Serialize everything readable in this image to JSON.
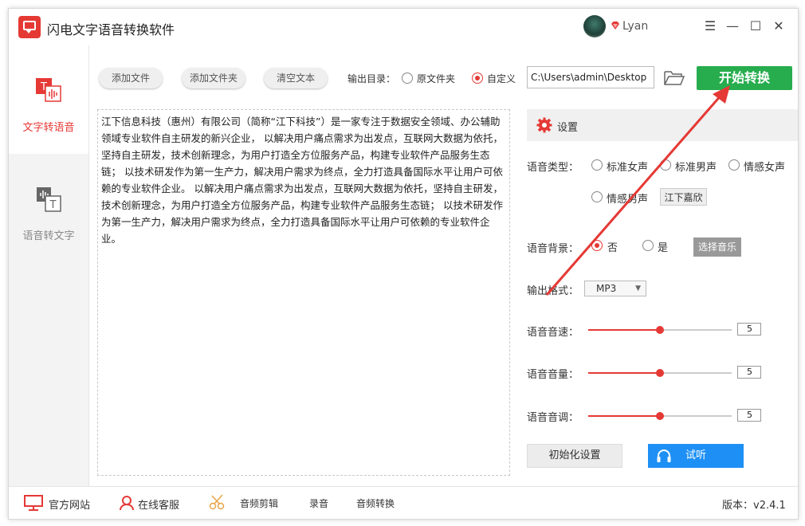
{
  "app": {
    "title": "闪电文字语音转换软件",
    "user": "Lyan"
  },
  "sidebar": {
    "items": [
      {
        "label": "文字转语音"
      },
      {
        "label": "语音转文字"
      }
    ]
  },
  "toolbar": {
    "add_file": "添加文件",
    "add_folder": "添加文件夹",
    "clear_text": "清空文本",
    "output_dir_label": "输出目录：",
    "original_folder": "原文件夹",
    "custom": "自定义",
    "output_path": "C:\\Users\\admin\\Desktop",
    "start": "开始转换"
  },
  "editor": {
    "text": "江下信息科技（惠州）有限公司（简称“江下科技”）是一家专注于数据安全领域、办公辅助领域专业软件自主研发的新兴企业， 以解决用户痛点需求为出发点，互联网大数据为依托，坚持自主研发，技术创新理念，为用户打造全方位服务产品，构建专业软件产品服务生态链； 以技术研发作为第一生产力，解决用户需求为终点，全力打造具备国际水平让用户可依赖的专业软件企业。 以解决用户痛点需求为出发点，互联网大数据为依托，坚持自主研发，技术创新理念，为用户打造全方位服务产品，构建专业软件产品服务生态链； 以技术研发作为第一生产力，解决用户需求为终点，全力打造具备国际水平让用户可依赖的专业软件企业。"
  },
  "settings": {
    "title": "设置",
    "voice_type_label": "语音类型：",
    "voices": [
      "标准女声",
      "标准男声",
      "情感女声",
      "情感男声"
    ],
    "voice_selected_name": "江下嘉欣",
    "bg_label": "语音背景：",
    "bg_no": "否",
    "bg_yes": "是",
    "choose_music": "选择音乐",
    "format_label": "输出格式：",
    "format_value": "MP3",
    "speed_label": "语音音速：",
    "speed_value": "5",
    "volume_label": "语音音量：",
    "volume_value": "5",
    "pitch_label": "语音音调：",
    "pitch_value": "5",
    "reset": "初始化设置",
    "listen": "试听"
  },
  "statusbar": {
    "website": "官方网站",
    "service": "在线客服",
    "audio_edit": "音频剪辑",
    "record": "录音",
    "audio_convert": "音频转换",
    "version": "版本：v2.4.1"
  },
  "colors": {
    "accent": "#e53935",
    "start": "#27ad4e",
    "listen": "#1e90f5"
  }
}
